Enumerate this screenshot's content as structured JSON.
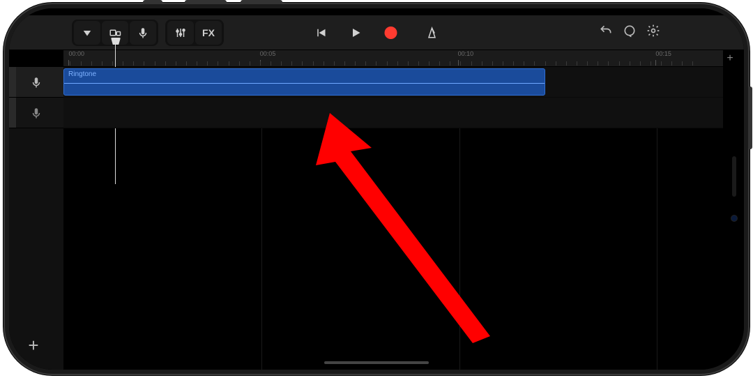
{
  "toolbar": {
    "fx_label": "FX"
  },
  "ruler": {
    "marks": [
      {
        "label": "00:00",
        "leftPct": 1
      },
      {
        "label": "00:05",
        "leftPct": 30
      },
      {
        "label": "00:10",
        "leftPct": 60
      },
      {
        "label": "00:15",
        "leftPct": 90
      }
    ]
  },
  "tracks": {
    "region_label": "Ringtone"
  },
  "annotation": {
    "arrow_color": "#ff0000"
  }
}
